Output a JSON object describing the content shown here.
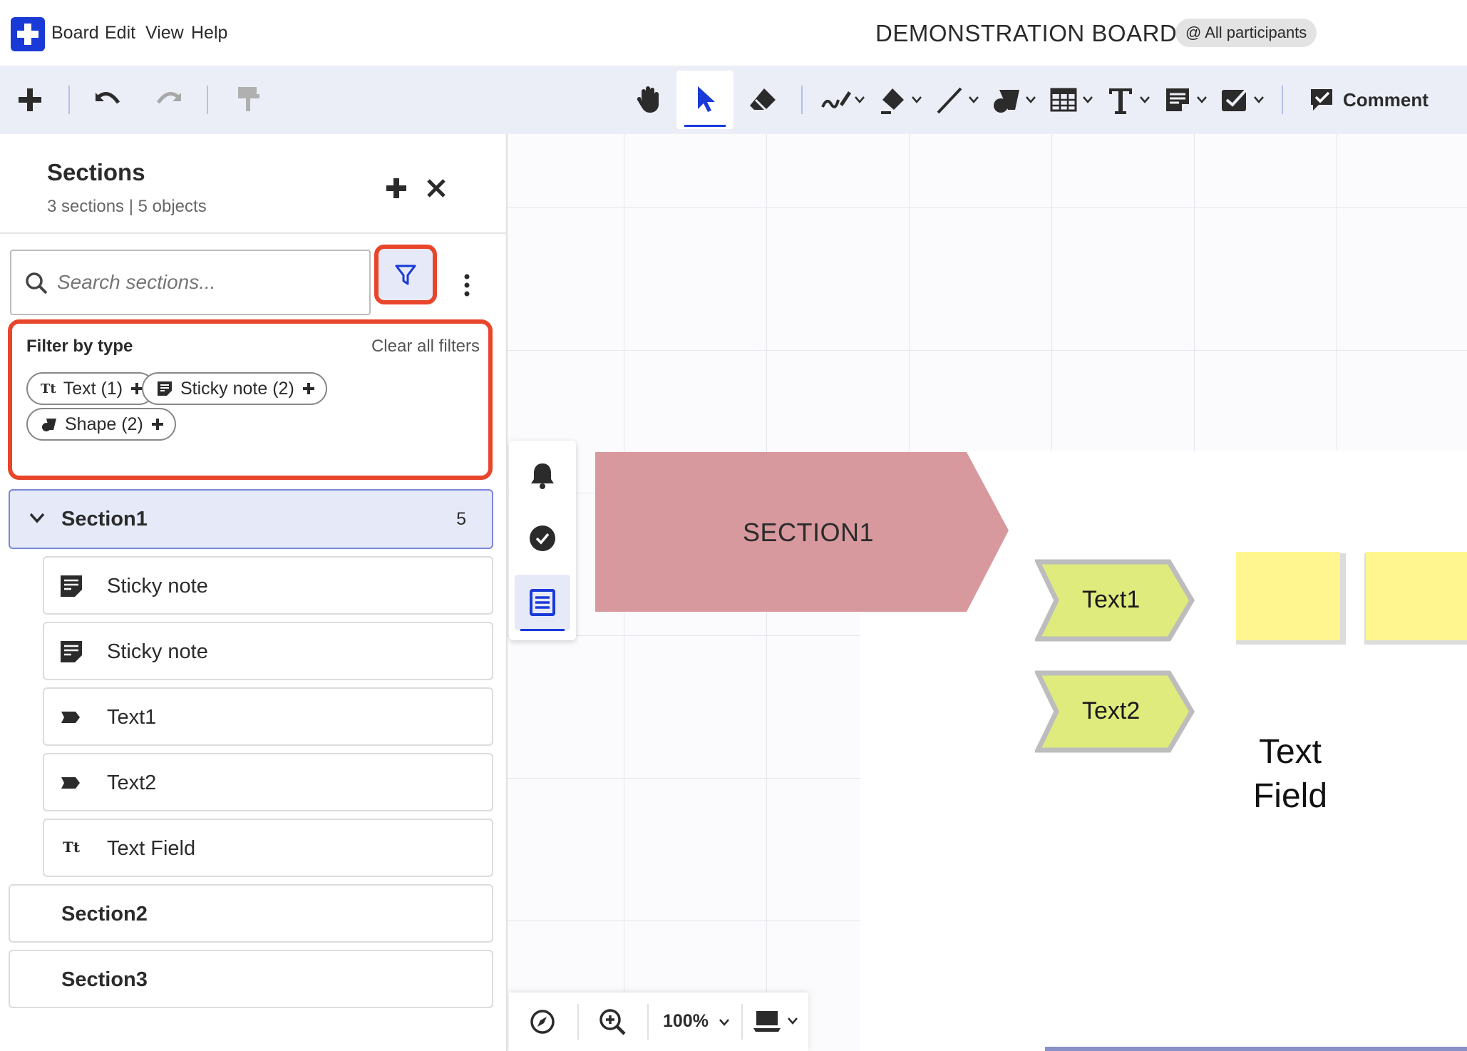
{
  "menubar": {
    "items": [
      "Board",
      "Edit",
      "View",
      "Help"
    ],
    "board_title": "DEMONSTRATION BOARD",
    "participants": "@ All participants"
  },
  "toolbar": {
    "tools": [
      "add-icon",
      "undo-icon",
      "redo-icon",
      "format-painter-icon",
      "hand-icon",
      "pointer-icon",
      "eraser-icon",
      "pen-icon",
      "fill-icon",
      "line-icon",
      "shapes-icon",
      "table-icon",
      "text-icon",
      "sticky-note-icon",
      "checkbox-icon"
    ],
    "comment_label": "Comment",
    "active_tool": "pointer-icon"
  },
  "panel": {
    "title": "Sections",
    "subtitle": "3 sections | 5 objects",
    "search_placeholder": "Search sections...",
    "filter": {
      "title": "Filter by type",
      "clear_label": "Clear all filters",
      "chips": [
        {
          "label": "Text (1)",
          "icon": "text-type-icon"
        },
        {
          "label": "Sticky note (2)",
          "icon": "sticky-note-icon"
        },
        {
          "label": "Shape (2)",
          "icon": "shape-icon"
        }
      ]
    },
    "sections": [
      {
        "name": "Section1",
        "count": "5",
        "expanded": true,
        "items": [
          {
            "label": "Sticky note",
            "icon": "sticky-note-icon"
          },
          {
            "label": "Sticky note",
            "icon": "sticky-note-icon"
          },
          {
            "label": "Text1",
            "icon": "tag-shape-icon"
          },
          {
            "label": "Text2",
            "icon": "tag-shape-icon"
          },
          {
            "label": "Text Field",
            "icon": "text-type-icon"
          }
        ]
      },
      {
        "name": "Section2",
        "expanded": false
      },
      {
        "name": "Section3",
        "expanded": false
      }
    ]
  },
  "rail": {
    "items": [
      "bell-icon",
      "check-circle-icon",
      "sections-list-icon"
    ],
    "active": "sections-list-icon"
  },
  "bottombar": {
    "zoom": "100%"
  },
  "canvas": {
    "section_banner": "SECTION1",
    "shapes": [
      "Text1",
      "Text2"
    ],
    "text_field": "Text Field"
  },
  "colors": {
    "accent": "#1a3ad8",
    "highlight": "#e8452b",
    "section_banner": "#d8999e",
    "shape_fill": "#dfeb7c",
    "sticky_fill": "#fff68f"
  }
}
